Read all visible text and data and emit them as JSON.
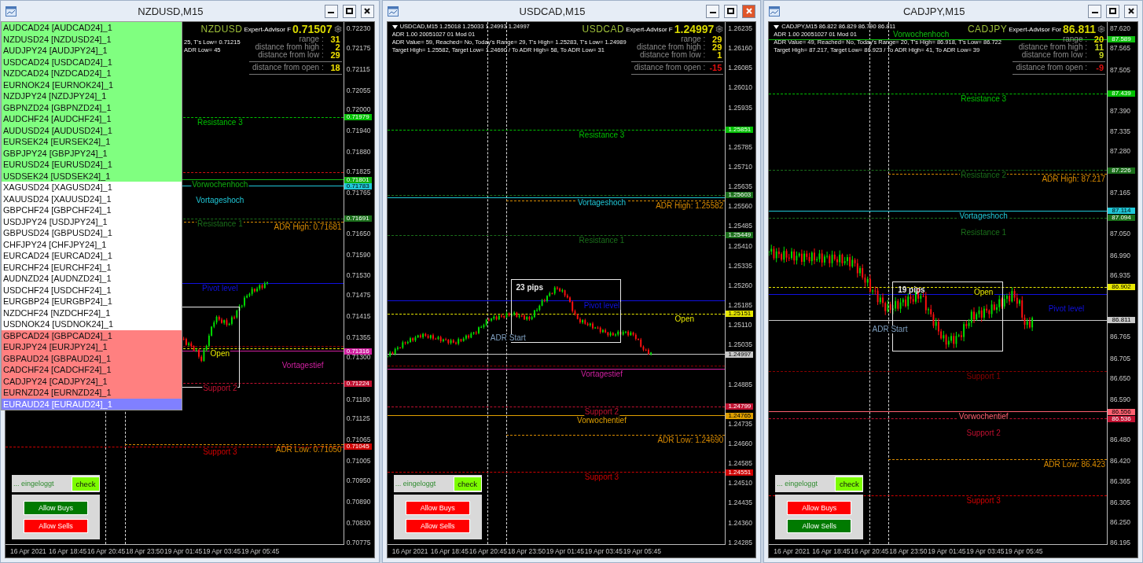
{
  "windows": [
    {
      "title": "NZDUSD,M15",
      "close_hover": false,
      "symbol_list": [
        {
          "label": "AUDCAD24 [AUDCAD24]_1",
          "color": "#80ff80",
          "selected": false
        },
        {
          "label": "NZDUSD24 [NZDUSD24]_1",
          "color": "#80ff80",
          "selected": false
        },
        {
          "label": "AUDJPY24 [AUDJPY24]_1",
          "color": "#80ff80",
          "selected": false
        },
        {
          "label": "USDCAD24 [USDCAD24]_1",
          "color": "#80ff80",
          "selected": false
        },
        {
          "label": "NZDCAD24 [NZDCAD24]_1",
          "color": "#80ff80",
          "selected": false
        },
        {
          "label": "EURNOK24 [EURNOK24]_1",
          "color": "#80ff80",
          "selected": false
        },
        {
          "label": "NZDJPY24 [NZDJPY24]_1",
          "color": "#80ff80",
          "selected": false
        },
        {
          "label": "GBPNZD24 [GBPNZD24]_1",
          "color": "#80ff80",
          "selected": false
        },
        {
          "label": "AUDCHF24 [AUDCHF24]_1",
          "color": "#80ff80",
          "selected": false
        },
        {
          "label": "AUDUSD24 [AUDUSD24]_1",
          "color": "#80ff80",
          "selected": false
        },
        {
          "label": "EURSEK24 [EURSEK24]_1",
          "color": "#80ff80",
          "selected": false
        },
        {
          "label": "GBPJPY24 [GBPJPY24]_1",
          "color": "#80ff80",
          "selected": false
        },
        {
          "label": "EURUSD24 [EURUSD24]_1",
          "color": "#80ff80",
          "selected": false
        },
        {
          "label": "USDSEK24 [USDSEK24]_1",
          "color": "#80ff80",
          "selected": false
        },
        {
          "label": "XAGUSD24 [XAGUSD24]_1",
          "color": "#ffffff",
          "selected": false
        },
        {
          "label": "XAUUSD24 [XAUUSD24]_1",
          "color": "#ffffff",
          "selected": false
        },
        {
          "label": "GBPCHF24 [GBPCHF24]_1",
          "color": "#ffffff",
          "selected": false
        },
        {
          "label": "USDJPY24 [USDJPY24]_1",
          "color": "#ffffff",
          "selected": false
        },
        {
          "label": "GBPUSD24 [GBPUSD24]_1",
          "color": "#ffffff",
          "selected": false
        },
        {
          "label": "CHFJPY24 [CHFJPY24]_1",
          "color": "#ffffff",
          "selected": false
        },
        {
          "label": "EURCAD24 [EURCAD24]_1",
          "color": "#ffffff",
          "selected": false
        },
        {
          "label": "EURCHF24 [EURCHF24]_1",
          "color": "#ffffff",
          "selected": false
        },
        {
          "label": "AUDNZD24 [AUDNZD24]_1",
          "color": "#ffffff",
          "selected": false
        },
        {
          "label": "USDCHF24 [USDCHF24]_1",
          "color": "#ffffff",
          "selected": false
        },
        {
          "label": "EURGBP24 [EURGBP24]_1",
          "color": "#ffffff",
          "selected": false
        },
        {
          "label": "NZDCHF24 [NZDCHF24]_1",
          "color": "#ffffff",
          "selected": false
        },
        {
          "label": "USDNOK24 [USDNOK24]_1",
          "color": "#ffffff",
          "selected": false
        },
        {
          "label": "GBPCAD24 [GBPCAD24]_1",
          "color": "#ff8080",
          "selected": false
        },
        {
          "label": "EURJPY24 [EURJPY24]_1",
          "color": "#ff8080",
          "selected": false
        },
        {
          "label": "GBPAUD24 [GBPAUD24]_1",
          "color": "#ff8080",
          "selected": false
        },
        {
          "label": "CADCHF24 [CADCHF24]_1",
          "color": "#ff8080",
          "selected": false
        },
        {
          "label": "CADJPY24 [CADJPY24]_1",
          "color": "#ff8080",
          "selected": false
        },
        {
          "label": "EURNZD24 [EURNZD24]_1",
          "color": "#ff8080",
          "selected": false
        },
        {
          "label": "EURAUD24 [EURAUD24]_1",
          "color": "#8080ff",
          "selected": true
        }
      ],
      "info_lines": [
        "25, T's Low= 0.71215",
        "ADR Low= 45"
      ],
      "stats": {
        "symbol": "NZDUSD",
        "ea": "Expert-Advisor F",
        "price": "0.71507",
        "rows": [
          {
            "label": "range :",
            "value": "31",
            "color": "#f0e000"
          },
          {
            "label": "distance from high :",
            "value": "2",
            "color": "#f0e000"
          },
          {
            "label": "distance from low :",
            "value": "29",
            "color": "#f0e000"
          }
        ],
        "open": {
          "label": "distance from open :",
          "value": "18",
          "color": "#f0e000"
        }
      },
      "ticks": [
        "0.72230",
        "0.72175",
        "0.72115",
        "0.72055",
        "0.72000",
        "0.71940",
        "0.71880",
        "0.71825",
        "0.71765",
        "0.71650",
        "0.71590",
        "0.71530",
        "0.71475",
        "0.71415",
        "0.71355",
        "0.71300",
        "0.71180",
        "0.71125",
        "0.71065",
        "0.71005",
        "0.70950",
        "0.70890",
        "0.70830",
        "0.70775"
      ],
      "levels": [
        {
          "kind": "level",
          "label": "Resistance 3",
          "tag": "0.71979",
          "color": "#00c000",
          "dashed": true
        },
        {
          "kind": "level",
          "color": "#d01010",
          "dashed": true
        },
        {
          "kind": "level",
          "label": "Vorwochenhoch",
          "tag": "0.71801",
          "color": "#10b010",
          "dashed": false
        },
        {
          "kind": "level",
          "label": "Vortageshoch",
          "tag": "0.71783",
          "color": "#20c8d8",
          "dashed": false
        },
        {
          "kind": "level",
          "label": "Resistance 1",
          "tag": "0.71691",
          "color": "#1a6e1a",
          "dashed": true
        },
        {
          "kind": "adr",
          "label": "ADR High: 0.71681",
          "color": "#d88a00",
          "dashed": true
        },
        {
          "kind": "level",
          "label": "Pivot level",
          "color": "#1010e0",
          "dashed": false
        },
        {
          "kind": "level",
          "color": "#8b0000",
          "dashed": true
        },
        {
          "kind": "level",
          "label": "Open",
          "color": "#e8e800",
          "dashed": true
        },
        {
          "kind": "level",
          "label": "Vortagestief",
          "tag": "0.71316",
          "color": "#d020a0",
          "dashed": false
        },
        {
          "kind": "level",
          "label": "Support 2",
          "tag": "0.71224",
          "color": "#c01030",
          "dashed": true
        },
        {
          "kind": "level",
          "label": "Support 3",
          "tag": "0.71045",
          "color": "#d00000",
          "dashed": true
        },
        {
          "kind": "adr",
          "label": "ADR Low: 0.71050",
          "color": "#d88a00",
          "dashed": true
        }
      ],
      "time_labels": [
        "16 Apr 2021",
        "16 Apr 18:45",
        "16 Apr 20:45",
        "18 Apr 23:50",
        "19 Apr 01:45",
        "19 Apr 03:45",
        "19 Apr 05:45"
      ],
      "controls": {
        "status": "... eingeloggt",
        "check": "check",
        "buttons": [
          {
            "label": "Allow Buys",
            "on": true
          },
          {
            "label": "Allow Sells",
            "on": false
          }
        ]
      }
    },
    {
      "title": "USDCAD,M15",
      "close_hover": true,
      "info_lines": [
        "USDCAD,M15  1.25018 1.25033 1.24993 1.24997",
        "ADR 1.00 20051027 01 Mod 01",
        "ADR Value= 59, Reached= No, Today's Range= 29, T's High= 1.25283, T's Low= 1.24989",
        "Target High= 1.25582, Target Low= 1.24690 / To ADR High= 58, To ADR Low= 31"
      ],
      "stats": {
        "symbol": "USDCAD",
        "ea": "Expert-Advisor F",
        "price": "1.24997",
        "rows": [
          {
            "label": "range :",
            "value": "29",
            "color": "#f0e000"
          },
          {
            "label": "distance from high :",
            "value": "29",
            "color": "#f0e000"
          },
          {
            "label": "distance from low :",
            "value": "1",
            "color": "#f0e000"
          }
        ],
        "open": {
          "label": "distance from open :",
          "value": "-15",
          "color": "#e01010"
        }
      },
      "ticks": [
        "1.26235",
        "1.26160",
        "1.26085",
        "1.26010",
        "1.25935",
        "1.25785",
        "1.25710",
        "1.25635",
        "1.25560",
        "1.25485",
        "1.25410",
        "1.25335",
        "1.25260",
        "1.25185",
        "1.25110",
        "1.25035",
        "1.24885",
        "1.24735",
        "1.24660",
        "1.24585",
        "1.24510",
        "1.24435",
        "1.24360",
        "1.24285"
      ],
      "levels": [
        {
          "kind": "level",
          "label": "Resistance 3",
          "tag": "1.25851",
          "color": "#00c000",
          "dashed": true
        },
        {
          "kind": "level",
          "tag": "1.25603",
          "color": "#1a6e1a",
          "dashed": true
        },
        {
          "kind": "level",
          "label": "Vortageshoch",
          "color": "#20c8d8",
          "dashed": false
        },
        {
          "kind": "adr",
          "label": "ADR High: 1.25582",
          "color": "#d88a00",
          "dashed": true
        },
        {
          "kind": "level",
          "label": "Resistance 1",
          "tag": "1.25449",
          "color": "#1a6e1a",
          "dashed": true
        },
        {
          "kind": "level",
          "label": "Pivot level",
          "color": "#1010e0",
          "dashed": false
        },
        {
          "kind": "level",
          "label": "Open",
          "tag": "1.25151",
          "color": "#e8e800",
          "dashed": true
        },
        {
          "kind": "level",
          "tag": "1.24997",
          "color": "#c8c8c8",
          "dashed": false
        },
        {
          "kind": "level",
          "color": "#8b0000",
          "dashed": true
        },
        {
          "kind": "level",
          "label": "Vortagestief",
          "color": "#d020a0",
          "dashed": false
        },
        {
          "kind": "level",
          "label": "Support 2",
          "tag": "1.24799",
          "color": "#c01030",
          "dashed": true
        },
        {
          "kind": "level",
          "label": "Vorwochentief",
          "tag": "1.24765",
          "color": "#e0a000",
          "dashed": false
        },
        {
          "kind": "adr",
          "label": "ADR Low: 1.24690",
          "color": "#d88a00",
          "dashed": true
        },
        {
          "kind": "level",
          "label": "Support 3",
          "tag": "1.24551",
          "color": "#d00000",
          "dashed": true
        }
      ],
      "range_box": {
        "label": "23 pips"
      },
      "adr_start": {
        "label": "ADR Start"
      },
      "time_labels": [
        "16 Apr 2021",
        "16 Apr 18:45",
        "16 Apr 20:45",
        "18 Apr 23:50",
        "19 Apr 01:45",
        "19 Apr 03:45",
        "19 Apr 05:45"
      ],
      "controls": {
        "status": "... eingeloggt",
        "check": "check",
        "buttons": [
          {
            "label": "Allow Buys",
            "on": false
          },
          {
            "label": "Allow Sells",
            "on": false
          }
        ]
      }
    },
    {
      "title": "CADJPY,M15",
      "close_hover": false,
      "info_lines": [
        "CADJPY,M15  86.822 86.829 86.790 86.811",
        "ADR 1.00 20051027 01 Mod 01",
        "ADR Value= 49, Reached= No, Today's Range= 20, T's High= 86.918, T's Low= 86.722",
        "Target High= 87.217, Target Low= 86.923 / To ADR High= 41, To ADR Low= 39"
      ],
      "stats": {
        "symbol": "CADJPY",
        "ea": "Expert-Advisor For",
        "price": "86.811",
        "rows": [
          {
            "label": "range :",
            "value": "20",
            "color": "#f0e000"
          },
          {
            "label": "distance from high :",
            "value": "11",
            "color": "#c8d820"
          },
          {
            "label": "distance from low :",
            "value": "9",
            "color": "#c8d820"
          }
        ],
        "open": {
          "label": "distance from open :",
          "value": "-9",
          "color": "#e01010"
        }
      },
      "ticks": [
        "87.620",
        "87.565",
        "87.505",
        "87.390",
        "87.335",
        "87.280",
        "87.165",
        "87.050",
        "86.990",
        "86.935",
        "86.765",
        "86.705",
        "86.650",
        "86.590",
        "86.480",
        "86.420",
        "86.365",
        "86.305",
        "86.250",
        "86.195"
      ],
      "levels": [
        {
          "kind": "level",
          "label": "Vorwochenhoch",
          "tag": "87.589",
          "color": "#10c010",
          "dashed": false
        },
        {
          "kind": "level",
          "label": "Resistance 3",
          "tag": "87.439",
          "color": "#00c000",
          "dashed": true
        },
        {
          "kind": "level",
          "label": "Resistance 2",
          "tag": "87.226",
          "color": "#1a6e1a",
          "dashed": true
        },
        {
          "kind": "adr",
          "label": "ADR High: 87.217",
          "color": "#d88a00",
          "dashed": true
        },
        {
          "kind": "level",
          "label": "Vortageshoch",
          "tag": "87.114",
          "color": "#20c8d8",
          "dashed": false
        },
        {
          "kind": "level",
          "label": "Resistance 1",
          "tag": "87.094",
          "color": "#1a6e1a",
          "dashed": true
        },
        {
          "kind": "level",
          "label": "Open",
          "tag": "86.902",
          "color": "#e8e800",
          "dashed": true
        },
        {
          "kind": "level",
          "label": "Pivot level",
          "color": "#1010e0",
          "dashed": false
        },
        {
          "kind": "level",
          "tag": "86.811",
          "color": "#c8c8c8",
          "dashed": false
        },
        {
          "kind": "level",
          "label": "Support 1",
          "color": "#8b0000",
          "dashed": true
        },
        {
          "kind": "level",
          "label": "Vorwochentief",
          "tag": "86.556",
          "color": "#ff6070",
          "dashed": false
        },
        {
          "kind": "level",
          "label": "Support 2",
          "tag": "86.536",
          "color": "#c01030",
          "dashed": true
        },
        {
          "kind": "adr",
          "label": "ADR Low: 86.423",
          "color": "#d88a00",
          "dashed": true
        },
        {
          "kind": "level",
          "label": "Support 3",
          "color": "#d00000",
          "dashed": true
        }
      ],
      "range_box": {
        "label": "19 pips"
      },
      "adr_start": {
        "label": "ADR Start"
      },
      "time_labels": [
        "16 Apr 2021",
        "16 Apr 18:45",
        "16 Apr 20:45",
        "18 Apr 23:50",
        "19 Apr 01:45",
        "19 Apr 03:45",
        "19 Apr 05:45"
      ],
      "controls": {
        "status": "... eingeloggt",
        "check": "check",
        "buttons": [
          {
            "label": "Allow Buys",
            "on": false
          },
          {
            "label": "Allow Sells",
            "on": true
          }
        ]
      }
    }
  ]
}
